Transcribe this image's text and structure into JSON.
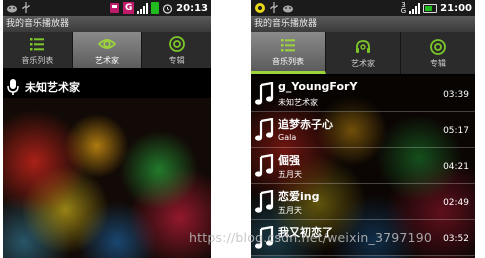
{
  "left_screen": {
    "status_bar": {
      "clock": "20:13"
    },
    "title": "我的音乐播放器",
    "tabs": [
      {
        "label": "音乐列表",
        "selected": false
      },
      {
        "label": "艺术家",
        "selected": true
      },
      {
        "label": "专辑",
        "selected": false
      }
    ],
    "artist_list": [
      {
        "name": "未知艺术家"
      }
    ]
  },
  "right_screen": {
    "status_bar": {
      "clock": "21:00"
    },
    "title": "我的音乐播放器",
    "tabs": [
      {
        "label": "音乐列表",
        "selected": true
      },
      {
        "label": "艺术家",
        "selected": false
      },
      {
        "label": "专辑",
        "selected": false
      }
    ],
    "songs": [
      {
        "title": "g_YoungForY",
        "artist": "未知艺术家",
        "duration": "03:39"
      },
      {
        "title": "追梦赤子心",
        "artist": "Gala",
        "duration": "05:17"
      },
      {
        "title": "倔强",
        "artist": "五月天",
        "duration": "04:21"
      },
      {
        "title": "恋爱ing",
        "artist": "五月天",
        "duration": "02:49"
      },
      {
        "title": "我又初恋了",
        "artist": "",
        "duration": "03:52"
      }
    ]
  },
  "watermark": "https://blog.csdn.net/weixin_3797190",
  "colors": {
    "accent_green": "#8ccf2a",
    "status_bar": "#1b1b1b",
    "title_bar": "#4a4a4a"
  },
  "icons": {
    "list": "list-icon",
    "artist": "eye-icon",
    "album": "disc-icon",
    "song": "music-note-icon",
    "artist_row": "microphone-icon"
  }
}
